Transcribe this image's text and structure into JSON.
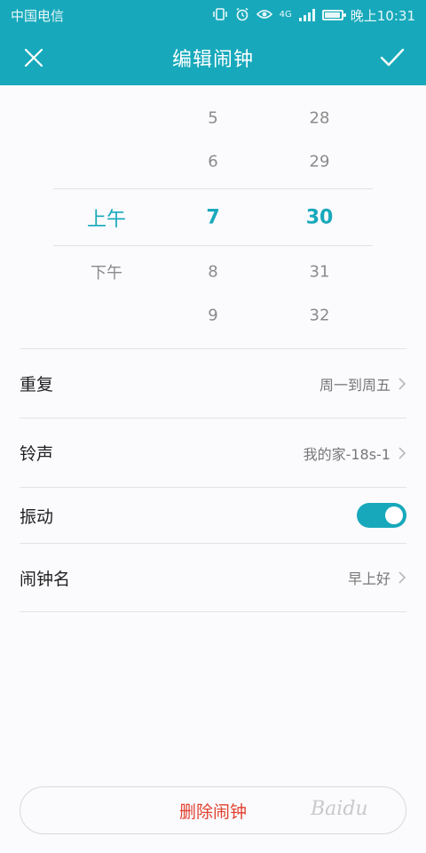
{
  "status_bar": {
    "carrier": "中国电信",
    "time": "晚上10:31",
    "network": "4G"
  },
  "header": {
    "title": "编辑闹钟",
    "close_icon": "close-icon",
    "confirm_icon": "check-icon"
  },
  "picker": {
    "ampm": [
      {
        "label": "上午",
        "selected": true
      },
      {
        "label": "下午",
        "selected": false
      }
    ],
    "hours": [
      {
        "label": "5",
        "selected": false
      },
      {
        "label": "6",
        "selected": false
      },
      {
        "label": "7",
        "selected": true
      },
      {
        "label": "8",
        "selected": false
      },
      {
        "label": "9",
        "selected": false
      }
    ],
    "minutes": [
      {
        "label": "28",
        "selected": false
      },
      {
        "label": "29",
        "selected": false
      },
      {
        "label": "30",
        "selected": true
      },
      {
        "label": "31",
        "selected": false
      },
      {
        "label": "32",
        "selected": false
      }
    ]
  },
  "settings": {
    "repeat": {
      "label": "重复",
      "value": "周一到周五"
    },
    "ringtone": {
      "label": "铃声",
      "value": "我的家-18s-1"
    },
    "vibrate": {
      "label": "振动",
      "on": true
    },
    "alarm_name": {
      "label": "闹钟名",
      "value": "早上好"
    }
  },
  "delete_label": "删除闹钟",
  "watermark_text": "Baidu",
  "colors": {
    "accent": "#17a9bb",
    "danger": "#e0412f"
  }
}
